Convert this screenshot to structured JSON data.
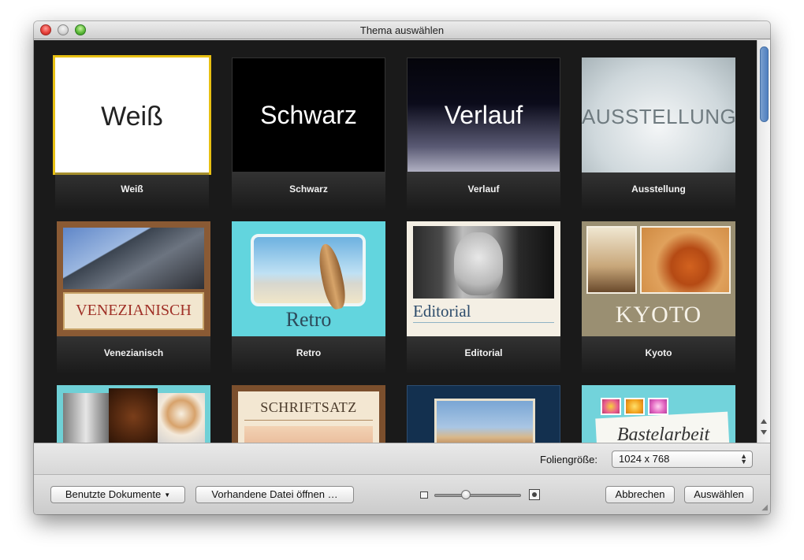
{
  "window": {
    "title": "Thema auswählen"
  },
  "themes": [
    {
      "label": "Weiß",
      "thumb_text": "Weiß",
      "selected": true
    },
    {
      "label": "Schwarz",
      "thumb_text": "Schwarz",
      "selected": false
    },
    {
      "label": "Verlauf",
      "thumb_text": "Verlauf",
      "selected": false
    },
    {
      "label": "Ausstellung",
      "thumb_text": "AUSSTELLUNG",
      "selected": false
    },
    {
      "label": "Venezianisch",
      "thumb_text": "VENEZIANISCH",
      "selected": false
    },
    {
      "label": "Retro",
      "thumb_text": "Retro",
      "selected": false
    },
    {
      "label": "Editorial",
      "thumb_text": "Editorial",
      "selected": false
    },
    {
      "label": "Kyoto",
      "thumb_text": "KYOTO",
      "selected": false
    },
    {
      "label": "",
      "thumb_text": "",
      "selected": false
    },
    {
      "label": "",
      "thumb_text": "SCHRIFTSATZ",
      "selected": false
    },
    {
      "label": "",
      "thumb_text": "",
      "selected": false
    },
    {
      "label": "",
      "thumb_text": "Bastelarbeit",
      "selected": false
    }
  ],
  "slide_size": {
    "label": "Foliengröße:",
    "value": "1024 x 768"
  },
  "buttons": {
    "recent": "Benutzte Dokumente",
    "open": "Vorhandene Datei öffnen …",
    "cancel": "Abbrechen",
    "choose": "Auswählen"
  },
  "zoom": {
    "level": 0.35
  },
  "colors": {
    "selection": "#e8c012",
    "grid_background": "#1a1a1a"
  }
}
